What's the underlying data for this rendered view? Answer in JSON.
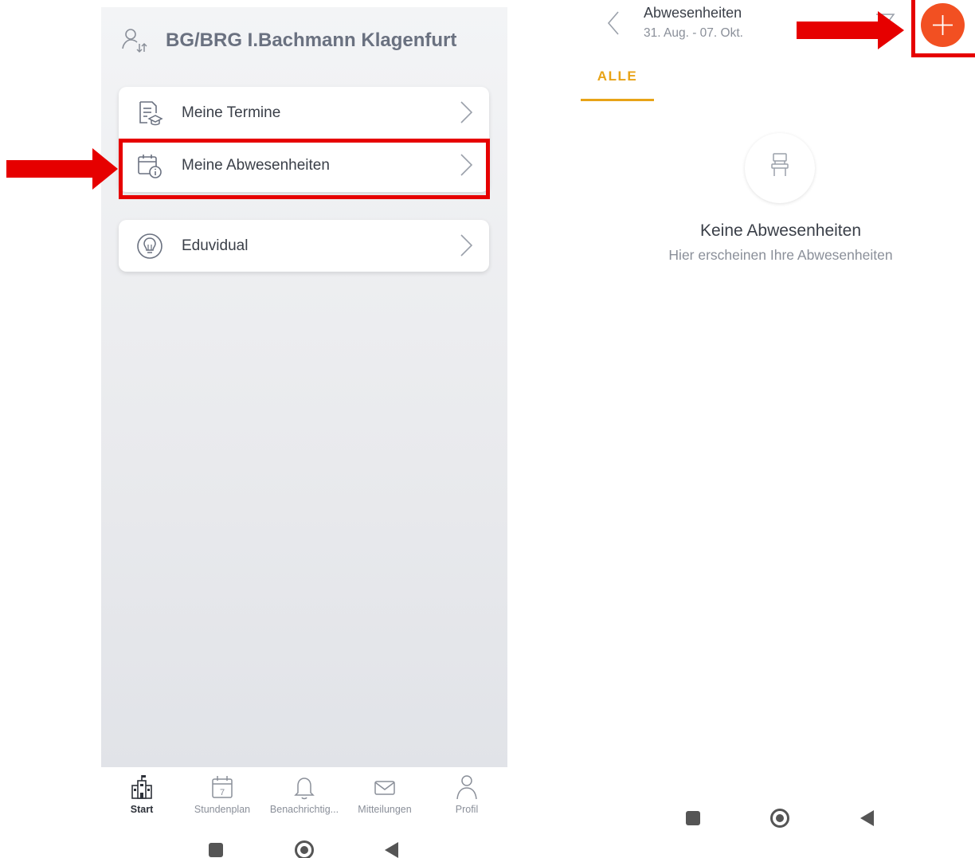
{
  "left_screen": {
    "school_name": "BG/BRG I.Bachmann Klagenfurt",
    "menu": [
      {
        "label": "Meine Termine",
        "icon": "document-graduation-icon"
      },
      {
        "label": "Meine Abwesenheiten",
        "icon": "calendar-info-icon",
        "highlighted": true
      },
      {
        "label": "Eduvidual",
        "icon": "lightbulb-icon"
      }
    ],
    "tabs": [
      {
        "label": "Start",
        "icon": "school-building-icon",
        "active": true
      },
      {
        "label": "Stundenplan",
        "icon": "calendar-icon",
        "badge": "7"
      },
      {
        "label": "Benachrichtig...",
        "icon": "bell-icon"
      },
      {
        "label": "Mitteilungen",
        "icon": "envelope-icon"
      },
      {
        "label": "Profil",
        "icon": "person-icon"
      }
    ]
  },
  "right_screen": {
    "title": "Abwesenheiten",
    "subtitle": "31. Aug. - 07. Okt.",
    "tab_label": "ALLE",
    "empty_title": "Keine Abwesenheiten",
    "empty_subtitle": "Hier erscheinen Ihre Abwesenheiten",
    "empty_icon": "chair-icon",
    "fab_icon": "plus-icon"
  },
  "colors": {
    "accent": "#e8a317",
    "fab": "#f25022",
    "highlight": "#e60000",
    "text_primary": "#3a3f48",
    "text_secondary": "#8a8f99"
  }
}
